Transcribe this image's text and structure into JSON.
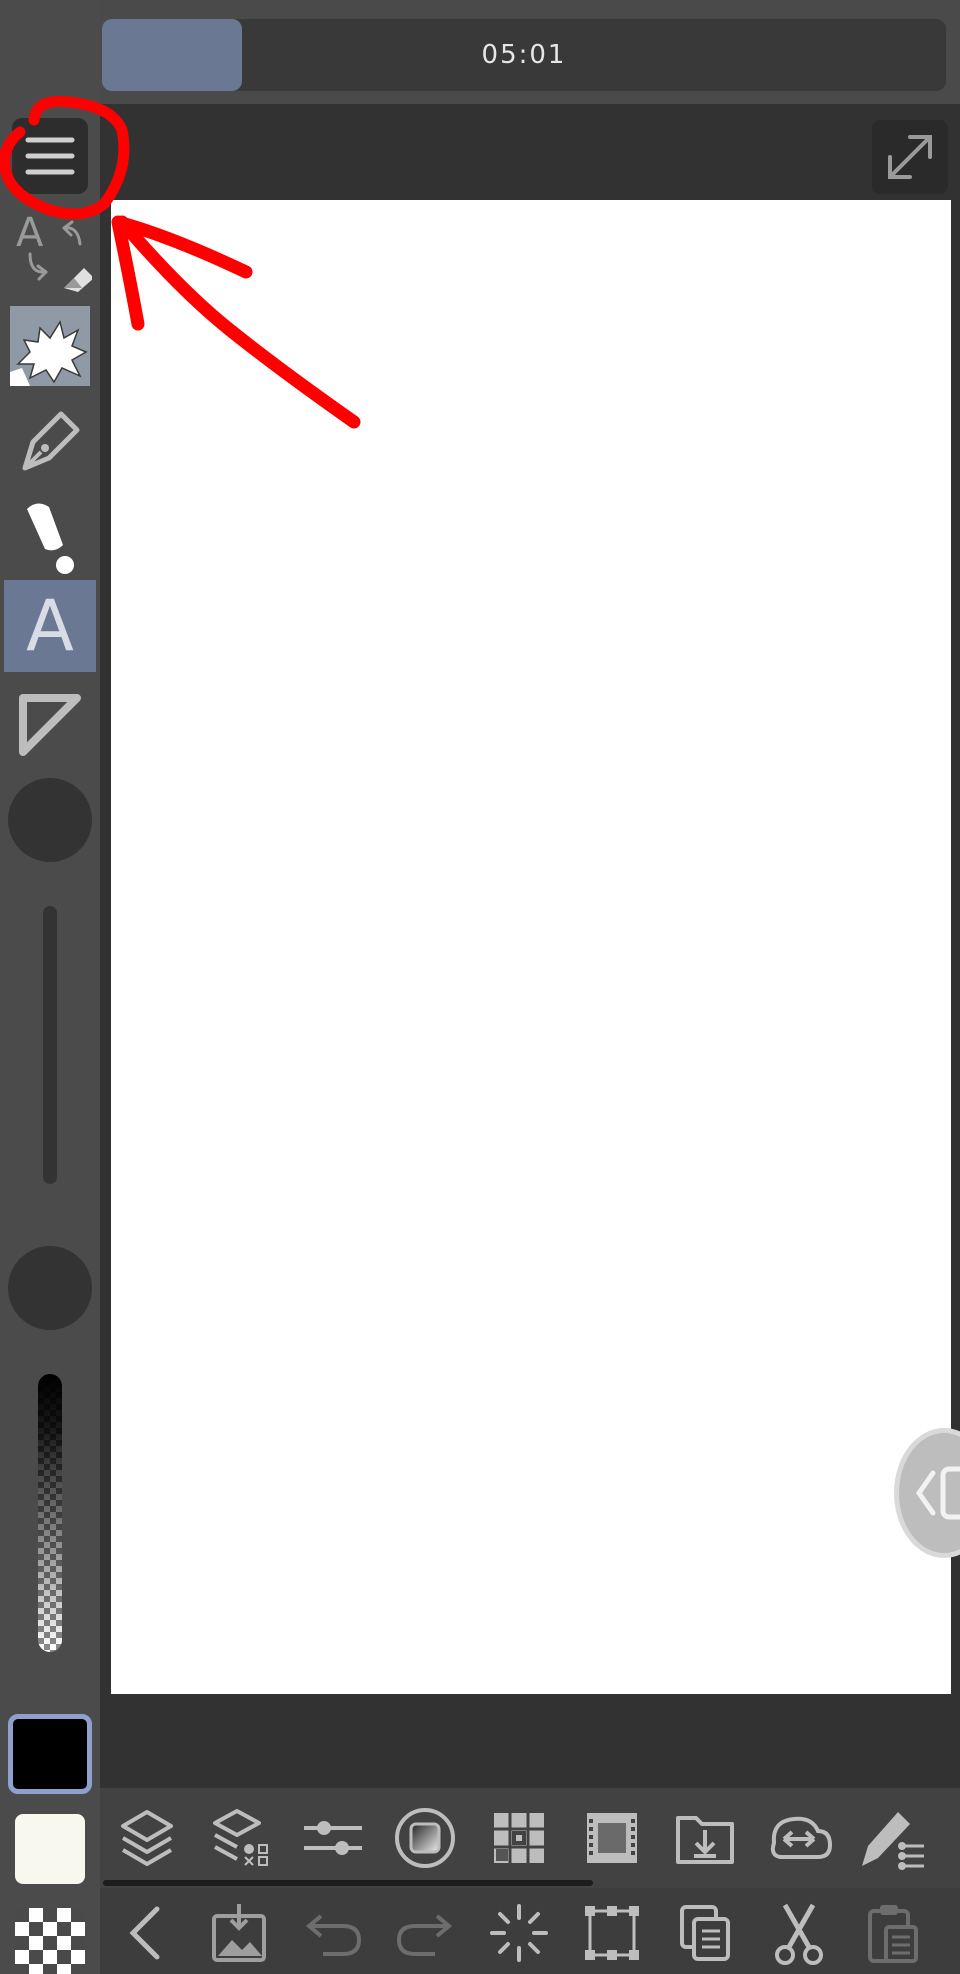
{
  "timeline": {
    "time": "05:01",
    "position": 0.14
  },
  "toolbar": {
    "menu": "menu-icon",
    "fullscreen": "expand-icon",
    "text_tool_glyph": "A",
    "swap_glyph": "A"
  },
  "bottom_toolbar": {
    "row1": [
      "layers-icon",
      "layer-properties-icon",
      "adjust-sliders-icon",
      "material-icon",
      "navigator-icon",
      "animation-icon",
      "import-icon",
      "sync-icon",
      "sub-tool-icon"
    ],
    "row2": [
      "back-icon",
      "save-image-icon",
      "undo-icon",
      "redo-icon",
      "loading-icon",
      "transform-icon",
      "copy-icon",
      "cut-icon",
      "paste-icon"
    ]
  },
  "colors": {
    "main_color": "#000000",
    "sub_color": "#f8f8ee",
    "accent": "#6a7894",
    "annotation": "#ff0000"
  }
}
